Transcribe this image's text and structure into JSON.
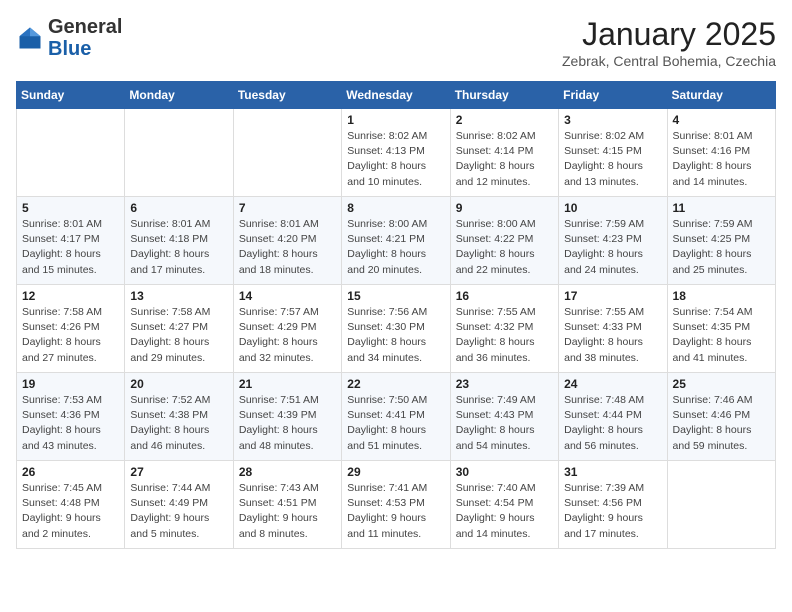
{
  "header": {
    "logo_general": "General",
    "logo_blue": "Blue",
    "month_title": "January 2025",
    "subtitle": "Zebrak, Central Bohemia, Czechia"
  },
  "weekdays": [
    "Sunday",
    "Monday",
    "Tuesday",
    "Wednesday",
    "Thursday",
    "Friday",
    "Saturday"
  ],
  "weeks": [
    [
      {
        "day": "",
        "info": ""
      },
      {
        "day": "",
        "info": ""
      },
      {
        "day": "",
        "info": ""
      },
      {
        "day": "1",
        "info": "Sunrise: 8:02 AM\nSunset: 4:13 PM\nDaylight: 8 hours\nand 10 minutes."
      },
      {
        "day": "2",
        "info": "Sunrise: 8:02 AM\nSunset: 4:14 PM\nDaylight: 8 hours\nand 12 minutes."
      },
      {
        "day": "3",
        "info": "Sunrise: 8:02 AM\nSunset: 4:15 PM\nDaylight: 8 hours\nand 13 minutes."
      },
      {
        "day": "4",
        "info": "Sunrise: 8:01 AM\nSunset: 4:16 PM\nDaylight: 8 hours\nand 14 minutes."
      }
    ],
    [
      {
        "day": "5",
        "info": "Sunrise: 8:01 AM\nSunset: 4:17 PM\nDaylight: 8 hours\nand 15 minutes."
      },
      {
        "day": "6",
        "info": "Sunrise: 8:01 AM\nSunset: 4:18 PM\nDaylight: 8 hours\nand 17 minutes."
      },
      {
        "day": "7",
        "info": "Sunrise: 8:01 AM\nSunset: 4:20 PM\nDaylight: 8 hours\nand 18 minutes."
      },
      {
        "day": "8",
        "info": "Sunrise: 8:00 AM\nSunset: 4:21 PM\nDaylight: 8 hours\nand 20 minutes."
      },
      {
        "day": "9",
        "info": "Sunrise: 8:00 AM\nSunset: 4:22 PM\nDaylight: 8 hours\nand 22 minutes."
      },
      {
        "day": "10",
        "info": "Sunrise: 7:59 AM\nSunset: 4:23 PM\nDaylight: 8 hours\nand 24 minutes."
      },
      {
        "day": "11",
        "info": "Sunrise: 7:59 AM\nSunset: 4:25 PM\nDaylight: 8 hours\nand 25 minutes."
      }
    ],
    [
      {
        "day": "12",
        "info": "Sunrise: 7:58 AM\nSunset: 4:26 PM\nDaylight: 8 hours\nand 27 minutes."
      },
      {
        "day": "13",
        "info": "Sunrise: 7:58 AM\nSunset: 4:27 PM\nDaylight: 8 hours\nand 29 minutes."
      },
      {
        "day": "14",
        "info": "Sunrise: 7:57 AM\nSunset: 4:29 PM\nDaylight: 8 hours\nand 32 minutes."
      },
      {
        "day": "15",
        "info": "Sunrise: 7:56 AM\nSunset: 4:30 PM\nDaylight: 8 hours\nand 34 minutes."
      },
      {
        "day": "16",
        "info": "Sunrise: 7:55 AM\nSunset: 4:32 PM\nDaylight: 8 hours\nand 36 minutes."
      },
      {
        "day": "17",
        "info": "Sunrise: 7:55 AM\nSunset: 4:33 PM\nDaylight: 8 hours\nand 38 minutes."
      },
      {
        "day": "18",
        "info": "Sunrise: 7:54 AM\nSunset: 4:35 PM\nDaylight: 8 hours\nand 41 minutes."
      }
    ],
    [
      {
        "day": "19",
        "info": "Sunrise: 7:53 AM\nSunset: 4:36 PM\nDaylight: 8 hours\nand 43 minutes."
      },
      {
        "day": "20",
        "info": "Sunrise: 7:52 AM\nSunset: 4:38 PM\nDaylight: 8 hours\nand 46 minutes."
      },
      {
        "day": "21",
        "info": "Sunrise: 7:51 AM\nSunset: 4:39 PM\nDaylight: 8 hours\nand 48 minutes."
      },
      {
        "day": "22",
        "info": "Sunrise: 7:50 AM\nSunset: 4:41 PM\nDaylight: 8 hours\nand 51 minutes."
      },
      {
        "day": "23",
        "info": "Sunrise: 7:49 AM\nSunset: 4:43 PM\nDaylight: 8 hours\nand 54 minutes."
      },
      {
        "day": "24",
        "info": "Sunrise: 7:48 AM\nSunset: 4:44 PM\nDaylight: 8 hours\nand 56 minutes."
      },
      {
        "day": "25",
        "info": "Sunrise: 7:46 AM\nSunset: 4:46 PM\nDaylight: 8 hours\nand 59 minutes."
      }
    ],
    [
      {
        "day": "26",
        "info": "Sunrise: 7:45 AM\nSunset: 4:48 PM\nDaylight: 9 hours\nand 2 minutes."
      },
      {
        "day": "27",
        "info": "Sunrise: 7:44 AM\nSunset: 4:49 PM\nDaylight: 9 hours\nand 5 minutes."
      },
      {
        "day": "28",
        "info": "Sunrise: 7:43 AM\nSunset: 4:51 PM\nDaylight: 9 hours\nand 8 minutes."
      },
      {
        "day": "29",
        "info": "Sunrise: 7:41 AM\nSunset: 4:53 PM\nDaylight: 9 hours\nand 11 minutes."
      },
      {
        "day": "30",
        "info": "Sunrise: 7:40 AM\nSunset: 4:54 PM\nDaylight: 9 hours\nand 14 minutes."
      },
      {
        "day": "31",
        "info": "Sunrise: 7:39 AM\nSunset: 4:56 PM\nDaylight: 9 hours\nand 17 minutes."
      },
      {
        "day": "",
        "info": ""
      }
    ]
  ]
}
